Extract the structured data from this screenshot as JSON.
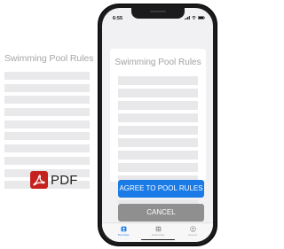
{
  "document": {
    "title": "Swimming Pool Rules",
    "line_count": 10
  },
  "pdf_badge": {
    "label": "PDF",
    "icon": "adobe-pdf-icon",
    "color": "#c5221f"
  },
  "phone": {
    "status_bar": {
      "time": "6:55",
      "icons": [
        "signal-icon",
        "wifi-icon",
        "battery-icon"
      ]
    },
    "card": {
      "title": "Swimming Pool Rules",
      "line_count": 11
    },
    "agree_button": {
      "label": "AGREE TO POOL RULES",
      "color": "#1a7be6"
    },
    "cancel_button": {
      "label": "CANCEL",
      "color": "#8f8f8f"
    },
    "tab_bar": {
      "tabs": [
        {
          "label": "Pool Pass",
          "icon": "person-badge-icon",
          "active": true
        },
        {
          "label": "Guest Pass",
          "icon": "group-icon",
          "active": false
        },
        {
          "label": "Account",
          "icon": "account-icon",
          "active": false
        }
      ]
    }
  }
}
